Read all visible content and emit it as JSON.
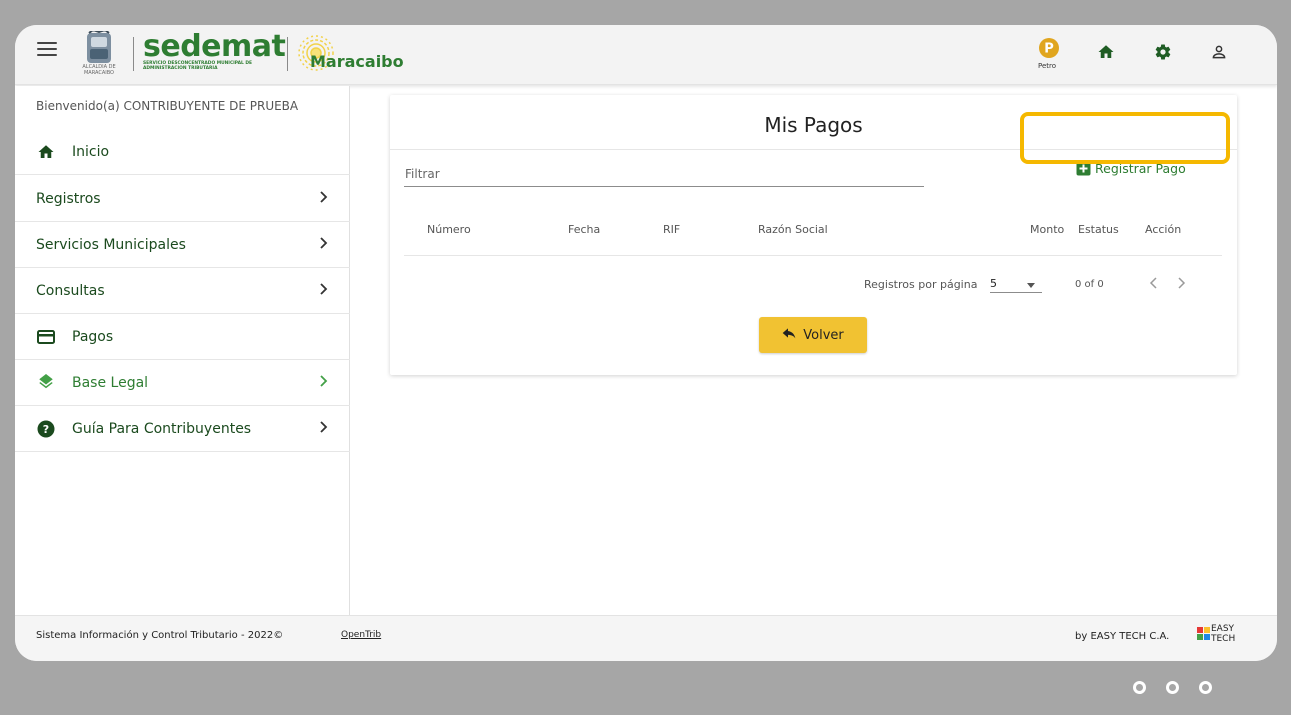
{
  "header": {
    "brand": "sedemat",
    "brand_sub": "SERVICIO DESCONCENTRADO MUNICIPAL DE ADMINISTRACION TRIBUTARIA",
    "crest_text": "ALCALDIA DE MARACAIBO",
    "city": "Maracaibo",
    "petro_label": "Petro",
    "icons": [
      "menu-icon",
      "petro-icon",
      "home-icon",
      "gear-icon",
      "user-icon"
    ]
  },
  "sidebar": {
    "welcome": "Bienvenido(a) CONTRIBUYENTE DE PRUEBA",
    "items": [
      {
        "label": "Inicio",
        "icon": "home-icon"
      },
      {
        "label": "Registros",
        "icon": ""
      },
      {
        "label": "Servicios Municipales",
        "icon": ""
      },
      {
        "label": "Consultas",
        "icon": ""
      },
      {
        "label": "Pagos",
        "icon": "credit-card-icon"
      },
      {
        "label": "Base Legal",
        "icon": "layers-icon"
      },
      {
        "label": "Guía Para Contribuyentes",
        "icon": "help-icon"
      }
    ]
  },
  "main": {
    "title": "Mis Pagos",
    "filter_label": "Filtrar",
    "register_button": "Registrar Pago",
    "columns": [
      "Número",
      "Fecha",
      "RIF",
      "Razón Social",
      "Monto",
      "Estatus",
      "Acción"
    ],
    "rows": [],
    "pager": {
      "rows_per_page_label": "Registros por página",
      "rows_per_page_value": "5",
      "range": "0 of 0"
    },
    "back_button": "Volver"
  },
  "footer": {
    "system_text": "Sistema Información y Control Tributario - 2022©",
    "opentrib": "OpenTrib",
    "by": "by EASY TECH C.A.",
    "logo_text": "EASY TECH"
  },
  "colors": {
    "brand_green": "#2e7d32",
    "highlight": "#f5b800",
    "back_button": "#f1c232"
  }
}
